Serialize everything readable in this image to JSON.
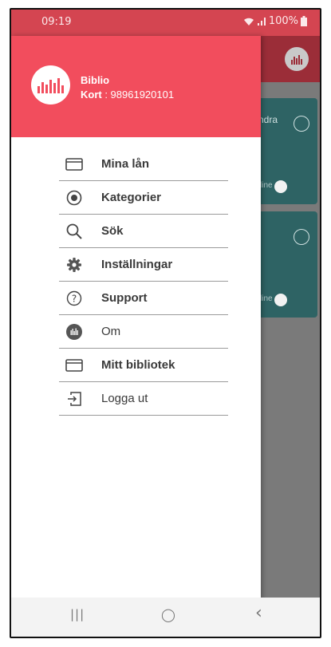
{
  "status_bar": {
    "time": "09:19",
    "battery_percent": "100%",
    "icons": [
      "wifi-icon",
      "signal-icon",
      "battery-icon"
    ]
  },
  "background_app": {
    "card1_text": "ndra",
    "card_toggle_text": "line"
  },
  "drawer": {
    "header": {
      "name": "Biblio",
      "card_label": "Kort",
      "card_number": " : 98961920101",
      "accent_color": "#f24d5d"
    },
    "items": [
      {
        "label": "Mina lån",
        "icon": "card-icon"
      },
      {
        "label": "Kategorier",
        "icon": "target-icon"
      },
      {
        "label": "Sök",
        "icon": "search-icon"
      },
      {
        "label": "Inställningar",
        "icon": "gear-icon"
      },
      {
        "label": "Support",
        "icon": "help-icon"
      },
      {
        "label": "Om",
        "icon": "info-logo-icon"
      },
      {
        "label": "Mitt bibliotek",
        "icon": "card-icon"
      },
      {
        "label": "Logga ut",
        "icon": "logout-icon"
      }
    ]
  },
  "nav_bar": {
    "recents_glyph": "|||",
    "home_glyph": "◯",
    "back_glyph": "‹"
  }
}
